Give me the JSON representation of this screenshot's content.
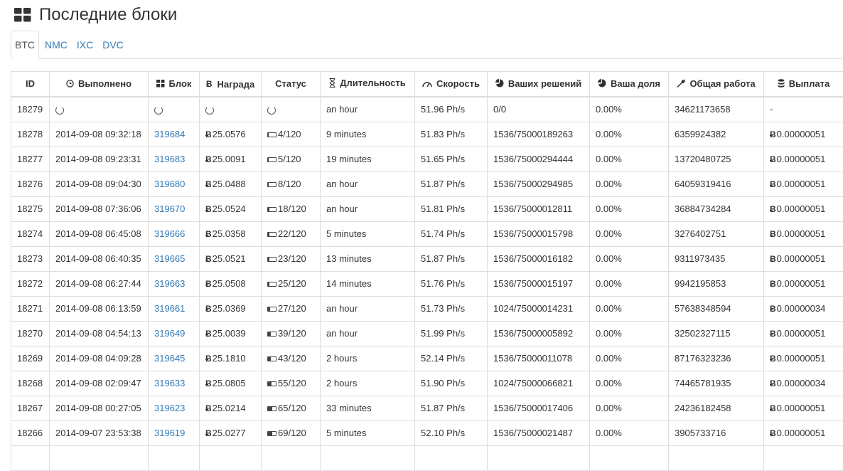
{
  "header": {
    "title": "Последние блоки"
  },
  "tabs": [
    {
      "label": "BTC",
      "active": true
    },
    {
      "label": "NMC",
      "active": false
    },
    {
      "label": "IXC",
      "active": false
    },
    {
      "label": "DVC",
      "active": false
    }
  ],
  "table": {
    "columns": [
      {
        "label": "ID",
        "icon": ""
      },
      {
        "label": "Выполнено",
        "icon": "clock-icon"
      },
      {
        "label": "Блок",
        "icon": "grid-icon"
      },
      {
        "label": "Награда",
        "icon": "bitcoin-icon"
      },
      {
        "label": "Статус",
        "icon": ""
      },
      {
        "label": "Длительность",
        "icon": "hourglass-icon"
      },
      {
        "label": "Скорость",
        "icon": "dashboard-icon"
      },
      {
        "label": "Ваших решений",
        "icon": "pie-icon"
      },
      {
        "label": "Ваша доля",
        "icon": "pie-icon"
      },
      {
        "label": "Общая работа",
        "icon": "wrench-icon"
      },
      {
        "label": "Выплата",
        "icon": "database-icon"
      }
    ],
    "rows": [
      {
        "id": "18279",
        "completed": "",
        "block": "",
        "reward": "",
        "status": "",
        "status_fill": 0,
        "duration": "an hour",
        "speed": "51.96 Ph/s",
        "shares": "0/0",
        "share": "0.00%",
        "work": "34621173658",
        "payout": "-",
        "pending": true
      },
      {
        "id": "18278",
        "completed": "2014-09-08 09:32:18",
        "block": "319684",
        "reward": "25.0576",
        "status": "4/120",
        "status_fill": 0.03,
        "duration": "9 minutes",
        "speed": "51.83 Ph/s",
        "shares": "1536/75000189263",
        "share": "0.00%",
        "work": "6359924382",
        "payout": "0.00000051",
        "pending": false
      },
      {
        "id": "18277",
        "completed": "2014-09-08 09:23:31",
        "block": "319683",
        "reward": "25.0091",
        "status": "5/120",
        "status_fill": 0.04,
        "duration": "19 minutes",
        "speed": "51.65 Ph/s",
        "shares": "1536/75000294444",
        "share": "0.00%",
        "work": "13720480725",
        "payout": "0.00000051",
        "pending": false
      },
      {
        "id": "18276",
        "completed": "2014-09-08 09:04:30",
        "block": "319680",
        "reward": "25.0488",
        "status": "8/120",
        "status_fill": 0.07,
        "duration": "an hour",
        "speed": "51.87 Ph/s",
        "shares": "1536/75000294985",
        "share": "0.00%",
        "work": "64059319416",
        "payout": "0.00000051",
        "pending": false
      },
      {
        "id": "18275",
        "completed": "2014-09-08 07:36:06",
        "block": "319670",
        "reward": "25.0524",
        "status": "18/120",
        "status_fill": 0.15,
        "duration": "an hour",
        "speed": "51.81 Ph/s",
        "shares": "1536/75000012811",
        "share": "0.00%",
        "work": "36884734284",
        "payout": "0.00000051",
        "pending": false
      },
      {
        "id": "18274",
        "completed": "2014-09-08 06:45:08",
        "block": "319666",
        "reward": "25.0358",
        "status": "22/120",
        "status_fill": 0.18,
        "duration": "5 minutes",
        "speed": "51.74 Ph/s",
        "shares": "1536/75000015798",
        "share": "0.00%",
        "work": "3276402751",
        "payout": "0.00000051",
        "pending": false
      },
      {
        "id": "18273",
        "completed": "2014-09-08 06:40:35",
        "block": "319665",
        "reward": "25.0521",
        "status": "23/120",
        "status_fill": 0.19,
        "duration": "13 minutes",
        "speed": "51.87 Ph/s",
        "shares": "1536/75000016182",
        "share": "0.00%",
        "work": "9311973435",
        "payout": "0.00000051",
        "pending": false
      },
      {
        "id": "18272",
        "completed": "2014-09-08 06:27:44",
        "block": "319663",
        "reward": "25.0508",
        "status": "25/120",
        "status_fill": 0.21,
        "duration": "14 minutes",
        "speed": "51.76 Ph/s",
        "shares": "1536/75000015197",
        "share": "0.00%",
        "work": "9942195853",
        "payout": "0.00000051",
        "pending": false
      },
      {
        "id": "18271",
        "completed": "2014-09-08 06:13:59",
        "block": "319661",
        "reward": "25.0369",
        "status": "27/120",
        "status_fill": 0.23,
        "duration": "an hour",
        "speed": "51.73 Ph/s",
        "shares": "1024/75000014231",
        "share": "0.00%",
        "work": "57638348594",
        "payout": "0.00000034",
        "pending": false
      },
      {
        "id": "18270",
        "completed": "2014-09-08 04:54:13",
        "block": "319649",
        "reward": "25.0039",
        "status": "39/120",
        "status_fill": 0.33,
        "duration": "an hour",
        "speed": "51.99 Ph/s",
        "shares": "1536/75000005892",
        "share": "0.00%",
        "work": "32502327115",
        "payout": "0.00000051",
        "pending": false
      },
      {
        "id": "18269",
        "completed": "2014-09-08 04:09:28",
        "block": "319645",
        "reward": "25.1810",
        "status": "43/120",
        "status_fill": 0.36,
        "duration": "2 hours",
        "speed": "52.14 Ph/s",
        "shares": "1536/75000011078",
        "share": "0.00%",
        "work": "87176323236",
        "payout": "0.00000051",
        "pending": false
      },
      {
        "id": "18268",
        "completed": "2014-09-08 02:09:47",
        "block": "319633",
        "reward": "25.0805",
        "status": "55/120",
        "status_fill": 0.46,
        "duration": "2 hours",
        "speed": "51.90 Ph/s",
        "shares": "1024/75000066821",
        "share": "0.00%",
        "work": "74465781935",
        "payout": "0.00000034",
        "pending": false
      },
      {
        "id": "18267",
        "completed": "2014-09-08 00:27:05",
        "block": "319623",
        "reward": "25.0214",
        "status": "65/120",
        "status_fill": 0.54,
        "duration": "33 minutes",
        "speed": "51.87 Ph/s",
        "shares": "1536/75000017406",
        "share": "0.00%",
        "work": "24236182458",
        "payout": "0.00000051",
        "pending": false
      },
      {
        "id": "18266",
        "completed": "2014-09-07 23:53:38",
        "block": "319619",
        "reward": "25.0277",
        "status": "69/120",
        "status_fill": 0.58,
        "duration": "5 minutes",
        "speed": "52.10 Ph/s",
        "shares": "1536/75000021487",
        "share": "0.00%",
        "work": "3905733716",
        "payout": "0.00000051",
        "pending": false
      },
      {
        "id": "",
        "completed": "",
        "block": "",
        "reward": "",
        "status": "",
        "status_fill": 0,
        "duration": "",
        "speed": "",
        "shares": "",
        "share": "",
        "work": "",
        "payout": "",
        "pending": false
      }
    ]
  },
  "colors": {
    "link": "#337ab7",
    "border": "#dddddd",
    "text": "#333333"
  },
  "coin_symbol": "Ƀ"
}
